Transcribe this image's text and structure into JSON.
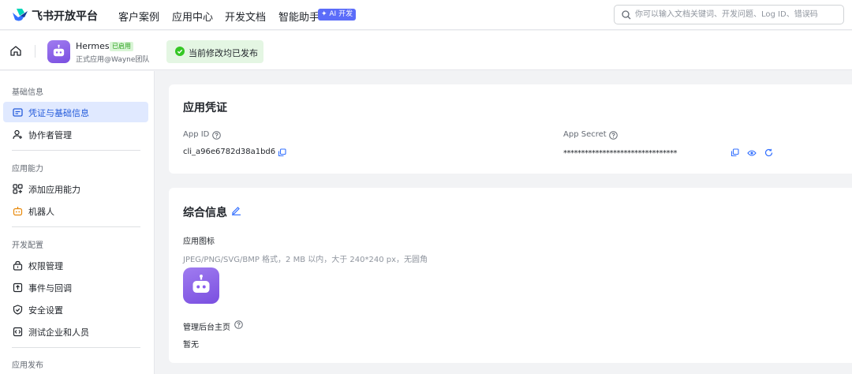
{
  "brand": {
    "name": "飞书开放平台",
    "accent": "#3370ff"
  },
  "nav": {
    "items": [
      "客户案例",
      "应用中心",
      "开发文档",
      "智能助手"
    ],
    "ai_badge": "✦ AI 开发"
  },
  "search": {
    "placeholder": "你可以输入文档关键词、开发问题、Log ID、错误码",
    "icon": "search-icon"
  },
  "app": {
    "name": "Hermes",
    "status": "已启用",
    "subtitle": "正式应用@Wayne团队",
    "publish_status": "当前修改均已发布"
  },
  "sidebar": {
    "sections": [
      {
        "title": "基础信息",
        "items": [
          {
            "label": "凭证与基础信息",
            "icon": "credential-icon",
            "active": true
          },
          {
            "label": "协作者管理",
            "icon": "user-add-icon"
          }
        ]
      },
      {
        "title": "应用能力",
        "items": [
          {
            "label": "添加应用能力",
            "icon": "apps-add-icon"
          },
          {
            "label": "机器人",
            "icon": "robot-icon"
          }
        ]
      },
      {
        "title": "开发配置",
        "items": [
          {
            "label": "权限管理",
            "icon": "lock-icon"
          },
          {
            "label": "事件与回调",
            "icon": "event-icon"
          },
          {
            "label": "安全设置",
            "icon": "shield-icon"
          },
          {
            "label": "测试企业和人员",
            "icon": "code-icon"
          }
        ]
      },
      {
        "title": "应用发布",
        "items": []
      }
    ]
  },
  "credentials": {
    "title": "应用凭证",
    "app_id_label": "App ID",
    "app_id_value": "cli_a96e6782d38a1bd6",
    "app_secret_label": "App Secret",
    "app_secret_value": "********************************"
  },
  "general": {
    "title": "综合信息",
    "icon_label": "应用图标",
    "icon_hint": "JPEG/PNG/SVG/BMP 格式，2 MB 以内，大于 240*240 px，无圆角",
    "homepage_label": "管理后台主页",
    "homepage_value": "暂无"
  }
}
